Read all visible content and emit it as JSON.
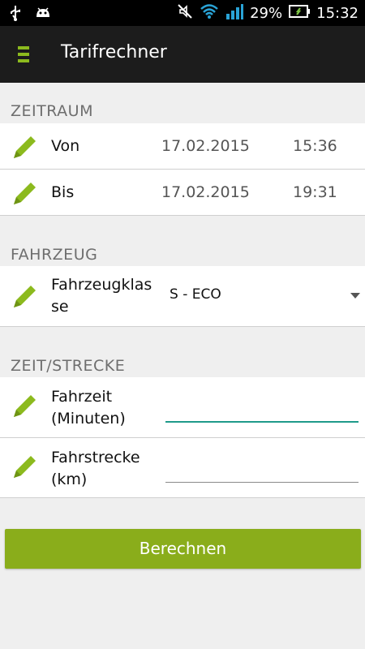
{
  "status_bar": {
    "battery_percent": "29%",
    "time": "15:32",
    "icons": [
      "usb-icon",
      "android-debug-icon",
      "mute-icon",
      "wifi-icon",
      "signal-icon",
      "battery-icon"
    ]
  },
  "app_bar": {
    "title": "Tarifrechner",
    "menu_icon": "menu-icon"
  },
  "sections": {
    "zeitraum": {
      "heading": "ZEITRAUM",
      "rows": [
        {
          "label": "Von",
          "date": "17.02.2015",
          "time": "15:36"
        },
        {
          "label": "Bis",
          "date": "17.02.2015",
          "time": "19:31"
        }
      ]
    },
    "fahrzeug": {
      "heading": "FAHRZEUG",
      "label_line1": "Fahrzeugklas",
      "label_line2": "se",
      "selected": "S - ECO"
    },
    "zeit_strecke": {
      "heading": "ZEIT/STRECKE",
      "fahrzeit_line1": "Fahrzeit",
      "fahrzeit_line2": "(Minuten)",
      "fahrzeit_value": "",
      "fahrstrecke_line1": "Fahrstrecke",
      "fahrstrecke_line2": "(km)",
      "fahrstrecke_value": ""
    }
  },
  "button": {
    "label": "Berechnen"
  },
  "colors": {
    "accent_green": "#8aad1b",
    "pencil_green": "#8cba1e",
    "focus_teal": "#1f9a8a"
  }
}
